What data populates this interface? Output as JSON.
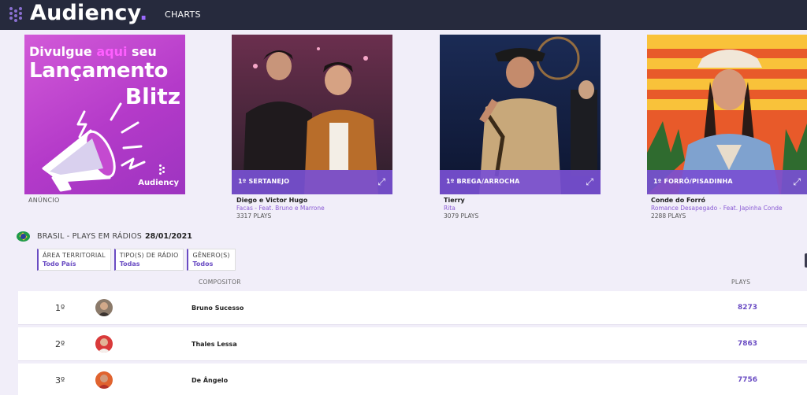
{
  "header": {
    "logo_text": "Audiency",
    "logo_dot": ".",
    "nav_charts": "CHARTS"
  },
  "ad": {
    "line1_a": "Divulgue ",
    "line1_highlight": "aqui",
    "line1_b": " seu",
    "line2": "Lançamento",
    "line3": "Blitz",
    "brand": "Audiency",
    "caption": "ANÚNCIO",
    "icon": "megaphone-icon"
  },
  "cards": [
    {
      "band": "1º SERTANEJO",
      "artist": "Diego e Victor Hugo",
      "song": "Facas - Feat. Bruno e Marrone",
      "plays": "3317 PLAYS"
    },
    {
      "band": "1º BREGA/ARROCHA",
      "artist": "Tierry",
      "song": "Rita",
      "plays": "3079 PLAYS"
    },
    {
      "band": "1º FORRÓ/PISADINHA",
      "artist": "Conde do Forró",
      "song": "Romance Desapegado - Feat. Japinha Conde",
      "plays": "2288 PLAYS"
    }
  ],
  "breadcrumb": {
    "text": "BRASIL - PLAYS EM RÁDIOS",
    "date": "28/01/2021"
  },
  "filters": [
    {
      "label": "ÁREA TERRITORIAL",
      "value": "Todo País"
    },
    {
      "label": "TIPO(S) DE RÁDIO",
      "value": "Todas"
    },
    {
      "label": "GÊNERO(S)",
      "value": "Todos"
    }
  ],
  "table": {
    "col_compositor": "COMPOSITOR",
    "col_plays": "PLAYS",
    "rows": [
      {
        "rank": "1º",
        "name": "Bruno Sucesso",
        "plays": "8273"
      },
      {
        "rank": "2º",
        "name": "Thales Lessa",
        "plays": "7863"
      },
      {
        "rank": "3º",
        "name": "De Ângelo",
        "plays": "7756"
      }
    ]
  },
  "colors": {
    "topbar": "#262a3d",
    "accent": "#6a4cc3",
    "band": "#7850d2",
    "background": "#f1eef9"
  }
}
